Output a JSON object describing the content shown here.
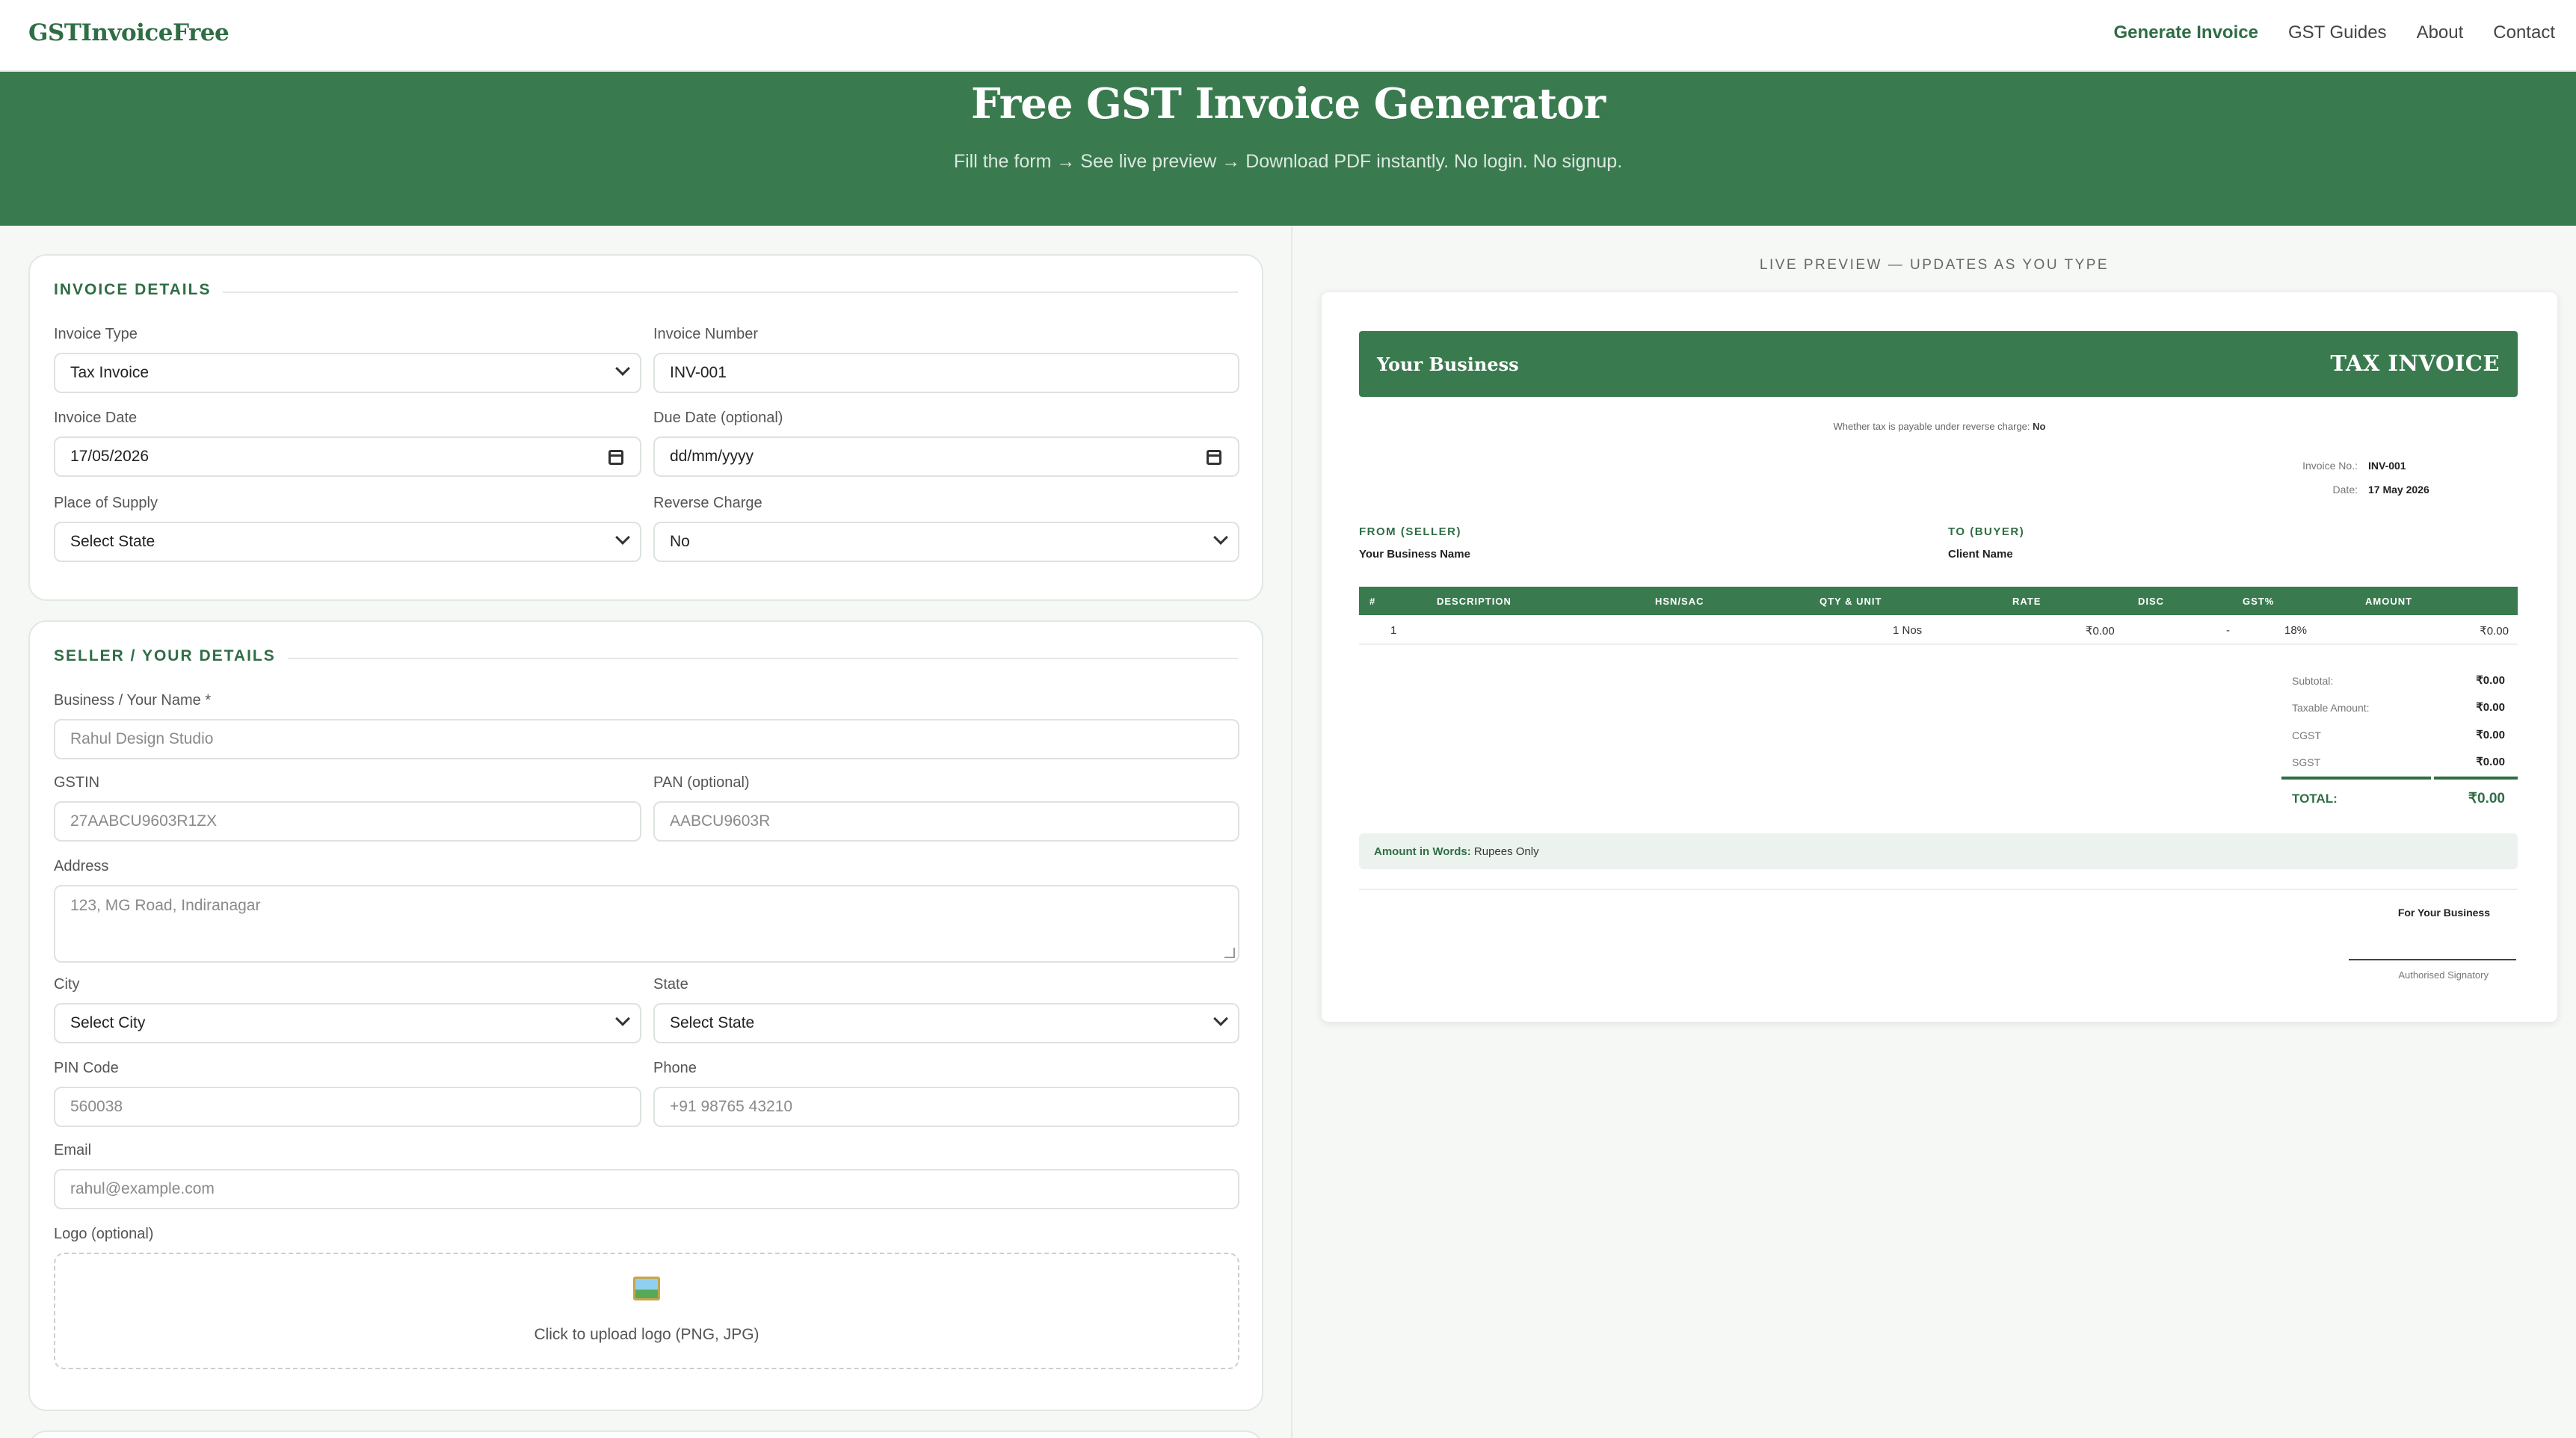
{
  "nav": {
    "logo": "GSTInvoiceFree",
    "links": [
      "Generate Invoice",
      "GST Guides",
      "About",
      "Contact"
    ]
  },
  "hero": {
    "title": "Free GST Invoice Generator",
    "subtitle": "Fill the form → See live preview → Download PDF instantly. No login. No signup."
  },
  "invoice_details": {
    "title": "INVOICE DETAILS",
    "invoice_type_label": "Invoice Type",
    "invoice_type_value": "Tax Invoice",
    "invoice_number_label": "Invoice Number",
    "invoice_number_value": "INV-001",
    "invoice_date_label": "Invoice Date",
    "invoice_date_value": "17/05/2026",
    "due_date_label": "Due Date (optional)",
    "due_date_placeholder": "dd/mm/yyyy",
    "place_label": "Place of Supply",
    "place_value": "Select State",
    "reverse_label": "Reverse Charge",
    "reverse_value": "No"
  },
  "seller": {
    "title": "SELLER / YOUR DETAILS",
    "name_label": "Business / Your Name *",
    "name_placeholder": "Rahul Design Studio",
    "gstin_label": "GSTIN",
    "gstin_placeholder": "27AABCU9603R1ZX",
    "pan_label": "PAN (optional)",
    "pan_placeholder": "AABCU9603R",
    "address_label": "Address",
    "address_placeholder": "123, MG Road, Indiranagar",
    "city_label": "City",
    "city_value": "Select City",
    "state_label": "State",
    "state_value": "Select State",
    "pin_label": "PIN Code",
    "pin_placeholder": "560038",
    "phone_label": "Phone",
    "phone_placeholder": "+91 98765 43210",
    "email_label": "Email",
    "email_placeholder": "rahul@example.com",
    "logo_label": "Logo (optional)",
    "upload_text": "Click to upload logo (PNG, JPG)"
  },
  "preview": {
    "label": "LIVE PREVIEW — UPDATES AS YOU TYPE",
    "business": "Your Business",
    "doc_type": "TAX INVOICE",
    "reverse_note": "Whether tax is payable under reverse charge:",
    "reverse_value": "No",
    "invoice_no_label": "Invoice No.:",
    "invoice_no_value": "INV-001",
    "date_label": "Date:",
    "date_value": "17 May 2026",
    "from_title": "FROM (SELLER)",
    "from_name": "Your Business Name",
    "to_title": "TO (BUYER)",
    "to_name": "Client Name",
    "columns": [
      "#",
      "DESCRIPTION",
      "HSN/SAC",
      "QTY & UNIT",
      "RATE",
      "DISC",
      "GST%",
      "AMOUNT"
    ],
    "row": {
      "num": "1",
      "qty": "1 Nos",
      "rate": "₹0.00",
      "disc": "-",
      "gst": "18%",
      "amount": "₹0.00"
    },
    "subtotal_label": "Subtotal:",
    "subtotal_value": "₹0.00",
    "taxable_label": "Taxable Amount:",
    "taxable_value": "₹0.00",
    "cgst_label": "CGST",
    "cgst_value": "₹0.00",
    "sgst_label": "SGST",
    "sgst_value": "₹0.00",
    "total_label": "TOTAL:",
    "total_value": "₹0.00",
    "words_label": "Amount in Words:",
    "words_value": "Rupees Only",
    "for_business": "For Your Business",
    "signatory": "Authorised Signatory"
  },
  "colors": {
    "brand": "#3a7a4f",
    "brand_text": "#2f6d45",
    "background": "#f5f8f5"
  }
}
